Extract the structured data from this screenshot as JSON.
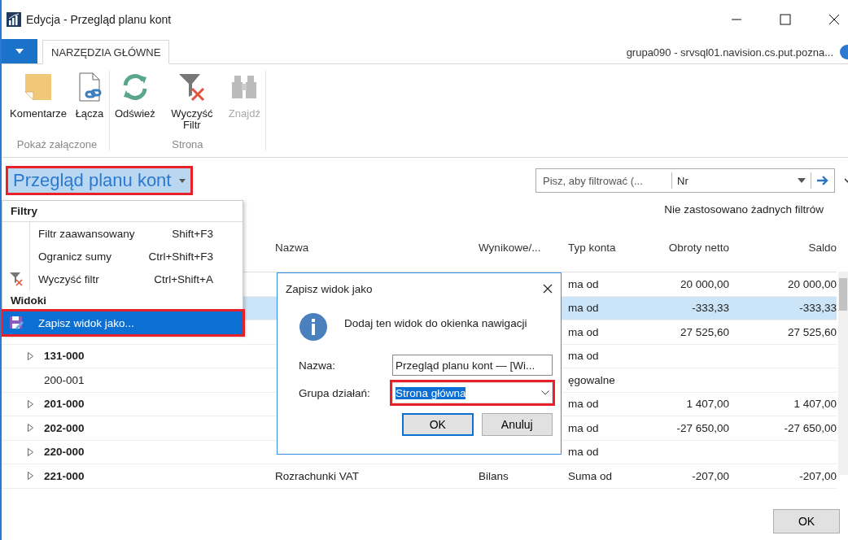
{
  "window": {
    "title": "Edycja - Przegląd planu kont"
  },
  "ribbon": {
    "tab": {
      "label": "NARZĘDZIA GŁÓWNE",
      "selected": true
    },
    "connection": "grupa090 - srvsql01.navision.cs.put.pozna...",
    "groups": [
      {
        "label": "Pokaż załączone",
        "actions": [
          {
            "kind": "note",
            "label": "Komentarze",
            "disabled": false
          },
          {
            "kind": "link",
            "label": "Łącza",
            "disabled": false
          }
        ]
      },
      {
        "label": "Strona",
        "actions": [
          {
            "kind": "refresh",
            "label": "Odśwież",
            "disabled": false
          },
          {
            "kind": "clearfilter",
            "label": "Wyczyść Filtr",
            "disabled": false
          },
          {
            "kind": "find",
            "label": "Znajdź",
            "disabled": true
          }
        ]
      }
    ]
  },
  "page": {
    "title": "Przegląd planu kont",
    "highlighted": true
  },
  "filter": {
    "placeholder": "Pisz, aby filtrować (...",
    "field": "Nr",
    "status": "Nie zastosowano żadnych filtrów"
  },
  "table": {
    "columns": [
      "Nazwa",
      "Wynikowe/...",
      "Typ konta",
      "Obroty netto",
      "Saldo"
    ],
    "rows": [
      {
        "selected": false,
        "type": "ma od",
        "net": "20 000,00",
        "balance": "20 000,00"
      },
      {
        "selected": true,
        "type": "ma od",
        "net": "-333,33",
        "balance": "-333,33"
      },
      {
        "selected": false,
        "type": "ma od",
        "net": "27 525,60",
        "balance": "27 525,60"
      },
      {
        "selected": false,
        "no": "131-000",
        "bold": true,
        "expandable": true,
        "type": "ma od"
      },
      {
        "selected": false,
        "no": "200-001",
        "bold": false,
        "expandable": false,
        "type": "ęgowalne"
      },
      {
        "selected": false,
        "no": "201-000",
        "bold": true,
        "expandable": true,
        "type": "ma od",
        "net": "1 407,00",
        "balance": "1 407,00"
      },
      {
        "selected": false,
        "no": "202-000",
        "bold": true,
        "expandable": true,
        "type": "ma od",
        "net": "-27 650,00",
        "balance": "-27 650,00"
      },
      {
        "selected": false,
        "no": "220-000",
        "bold": true,
        "expandable": true,
        "type": "ma od"
      },
      {
        "selected": false,
        "no": "221-000",
        "bold": true,
        "expandable": true,
        "name": "Rozrachunki VAT",
        "result": "Bilans",
        "type": "Suma od",
        "net": "-207,00",
        "balance": "-207,00"
      }
    ]
  },
  "menu": {
    "sections": [
      {
        "header": "Filtry",
        "items": [
          {
            "label": "Filtr zaawansowany",
            "shortcut": "Shift+F3",
            "kind": "plain",
            "selected": false,
            "highlighted": false
          },
          {
            "label": "Ogranicz sumy",
            "shortcut": "Ctrl+Shift+F3",
            "kind": "plain",
            "selected": false,
            "highlighted": false
          },
          {
            "label": "Wyczyść filtr",
            "shortcut": "Ctrl+Shift+A",
            "kind": "clear",
            "selected": false,
            "highlighted": false
          }
        ]
      },
      {
        "header": "Widoki",
        "items": [
          {
            "label": "Zapisz widok jako...",
            "kind": "save",
            "selected": true,
            "highlighted": true
          }
        ]
      }
    ]
  },
  "dialog": {
    "title": "Zapisz widok jako",
    "message": "Dodaj ten widok do okienka nawigacji",
    "fields": [
      {
        "kind": "text",
        "label": "Nazwa:",
        "value": "Przegląd planu kont — [Wi...",
        "highlighted": false
      },
      {
        "kind": "select",
        "label": "Grupa działań:",
        "value": "Strona główna",
        "highlighted": true
      }
    ],
    "buttons": [
      {
        "label": "OK",
        "focused": true
      },
      {
        "label": "Anuluj",
        "focused": false
      }
    ]
  },
  "footer": {
    "button": "OK"
  }
}
